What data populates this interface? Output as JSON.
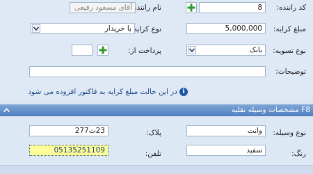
{
  "form": {
    "driver_code": {
      "label": "کد راننده:",
      "value": "8"
    },
    "driver_name": {
      "label": "نام راننده:",
      "value": "آقای مسعود رفیعی"
    },
    "fare_amount": {
      "label": "مبلغ کرایه:",
      "value": "5,000,000"
    },
    "fare_type": {
      "label": "نوع کرایه:",
      "value": "با خریدار"
    },
    "settlement_type": {
      "label": "نوع تسویه:",
      "value": "بانک"
    },
    "paid_from": {
      "label": "پرداخت از:",
      "value": ""
    },
    "description": {
      "label": "توضیحات:",
      "value": ""
    },
    "info_message": "در این حالت مبلغ کرایه به فاکتور افزوده می شود"
  },
  "vehicle_section": {
    "title": "F8 مشخصات وسیله نقلیه",
    "vehicle_type": {
      "label": "نوع وسیله:",
      "value": "وانت"
    },
    "plate": {
      "label": "پلاک:",
      "value": "23ت277"
    },
    "color": {
      "label": "رنگ:",
      "value": "سفید"
    },
    "phone": {
      "label": "تلفن:",
      "value": "05135251109"
    }
  },
  "icons": {
    "add": "plus-icon",
    "dropdown": "chevron-down-icon",
    "info": "info-icon",
    "collapse": "chevron-up-icon"
  },
  "colors": {
    "plus_green": "#2e9a2e",
    "section_header": "#5a87c5",
    "highlight": "#ffff99",
    "info_text": "#1f4a86"
  }
}
